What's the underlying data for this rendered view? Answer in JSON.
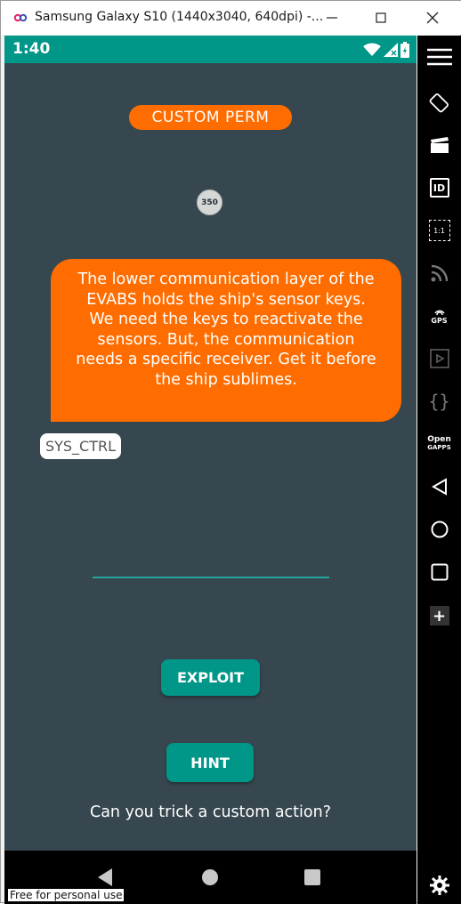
{
  "window": {
    "title": "Samsung Galaxy S10 (1440x3040, 640dpi) -..."
  },
  "statusbar": {
    "time": "1:40"
  },
  "app": {
    "perm_label": "CUSTOM PERM",
    "score": "350",
    "message": "The lower communication layer of the EVABS holds the ship's sensor keys. We need the keys to reactivate the sensors. But, the communication needs a specific receiver. Get it before the ship sublimes.",
    "chip_label": "SYS_CTRL",
    "input_value": "",
    "exploit_label": "EXPLOIT",
    "hint_label": "HINT",
    "question": "Can you trick a custom action?",
    "colors": {
      "accent": "#ff6d00",
      "teal": "#009688",
      "background": "#37474f"
    }
  },
  "sidebar": {
    "id_label": "ID",
    "scale_label": "1:1",
    "gps_label": "GPS",
    "open_label": "Open",
    "gapps_label": "GAPPS",
    "icons": [
      "menu-icon",
      "rotate-icon",
      "camera-icon",
      "id-icon",
      "scale-icon",
      "signal-icon",
      "gps-icon",
      "video-icon",
      "code-icon",
      "gapps-icon",
      "back-icon",
      "home-icon",
      "recents-icon",
      "add-icon",
      "settings-icon"
    ]
  },
  "watermark": "Free for personal use"
}
